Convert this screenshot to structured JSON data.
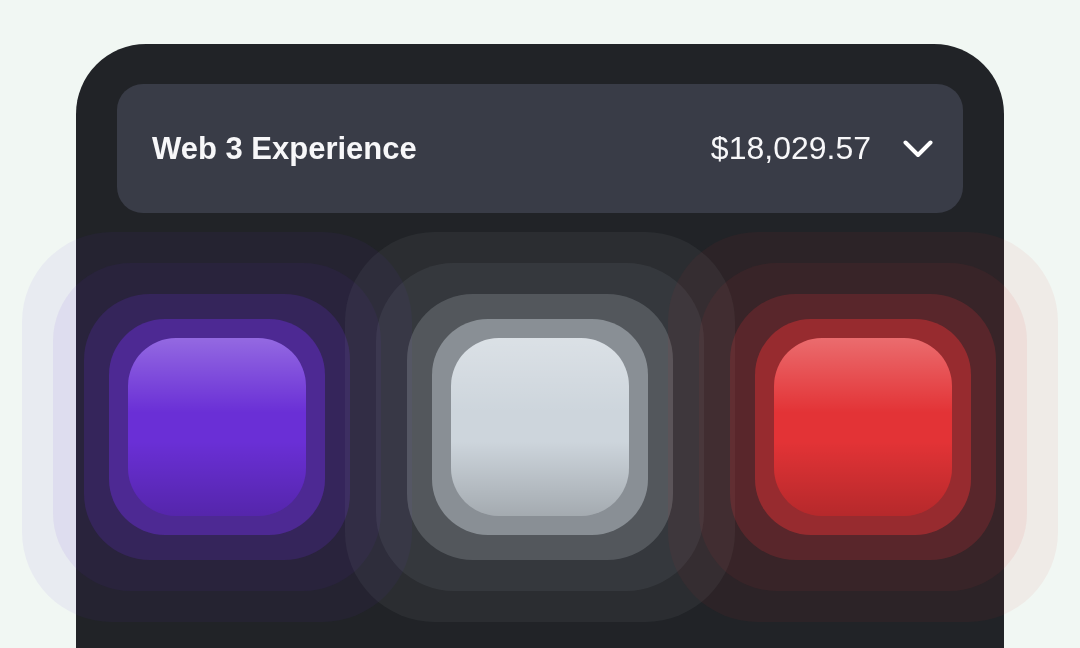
{
  "header": {
    "title": "Web 3 Experience",
    "balance": "$18,029.57",
    "expanded": false
  },
  "tiles": [
    {
      "color": "#6a2fd6"
    },
    {
      "color": "#cdd5dc"
    },
    {
      "color": "#e33336"
    }
  ]
}
